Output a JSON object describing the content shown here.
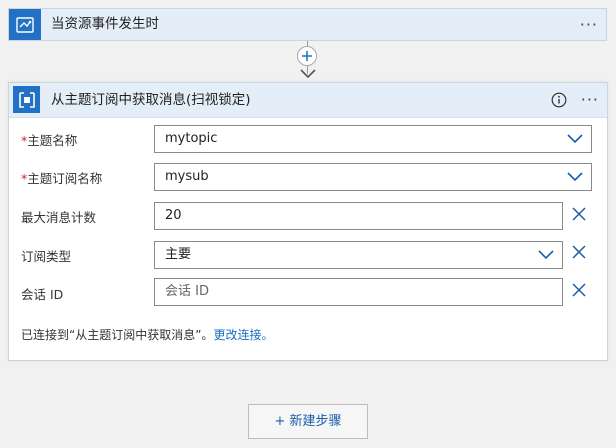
{
  "trigger": {
    "title": "当资源事件发生时",
    "more_label": "···",
    "icon": "event-grid-icon"
  },
  "action": {
    "title": "从主题订阅中获取消息(扫视锁定)",
    "more_label": "···",
    "icon": "service-bus-icon",
    "fields": {
      "topic_name": {
        "label": "主题名称",
        "required_mark": "*",
        "value": "mytopic"
      },
      "subscription_name": {
        "label": "主题订阅名称",
        "required_mark": "*",
        "value": "mysub"
      },
      "max_message_count": {
        "label": "最大消息计数",
        "value": "20"
      },
      "subscription_type": {
        "label": "订阅类型",
        "value": "主要"
      },
      "session_id": {
        "label": "会话 ID",
        "placeholder": "会话 ID"
      }
    },
    "connection": {
      "text": "已连接到“从主题订阅中获取消息”。",
      "change_link": "更改连接。"
    }
  },
  "new_step": {
    "label": "+ 新建步骤"
  },
  "colors": {
    "accent": "#2371c6",
    "header_bg": "#e3eef8",
    "link": "#1a6fc4",
    "required": "#c4262e"
  }
}
